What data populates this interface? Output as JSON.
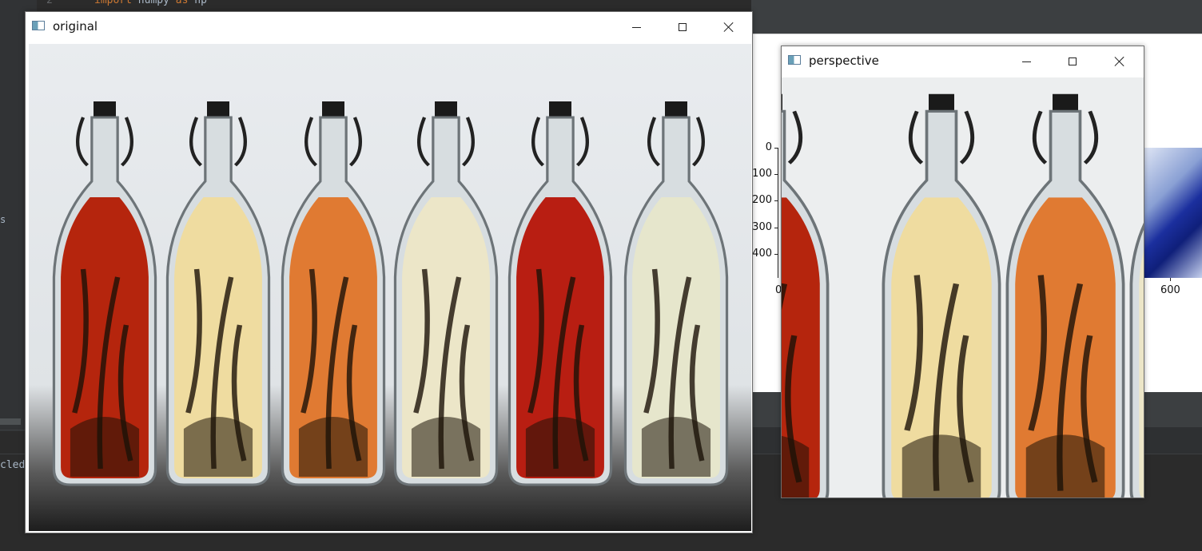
{
  "ide": {
    "line_number": "2",
    "code_keyword_import": "import",
    "code_module": " numpy ",
    "code_keyword_as": "as",
    "code_alias": " np",
    "side_char": "s",
    "console_text": "cled"
  },
  "figure": {
    "y_tick_labels": [
      "0",
      "100",
      "200",
      "300",
      "400"
    ],
    "x_tick_labels": [
      "0",
      "600"
    ]
  },
  "windows": {
    "original": {
      "title": "original"
    },
    "perspective": {
      "title": "perspective"
    }
  },
  "bottles": {
    "liquid_colors": [
      "#b5250d",
      "#efdca0",
      "#e07a32",
      "#ece6c8",
      "#b81e12",
      "#e6e6cc"
    ]
  }
}
